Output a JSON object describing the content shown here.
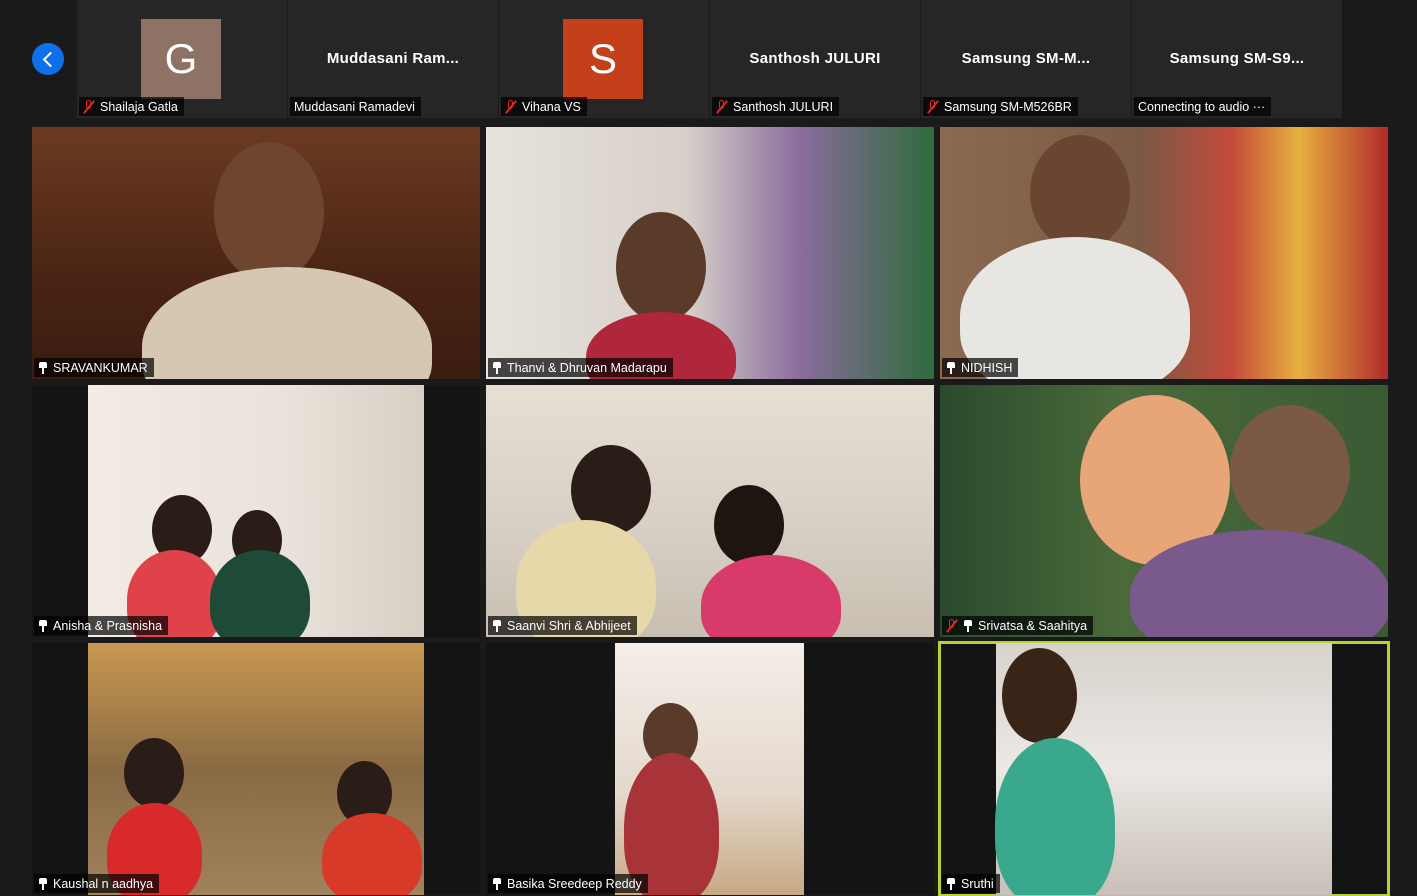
{
  "strip": {
    "participants": [
      {
        "avatar_letter": "G",
        "avatar_color": "#8d7265",
        "label": "Shailaja Gatla",
        "muted": true
      },
      {
        "display": "Muddasani  Ram...",
        "label": "Muddasani Ramadevi",
        "muted": false
      },
      {
        "avatar_letter": "S",
        "avatar_color": "#c3401a",
        "label": "Vihana VS",
        "muted": true
      },
      {
        "display": "Santhosh JULURI",
        "label": "Santhosh JULURI",
        "muted": true
      },
      {
        "display": "Samsung  SM-M...",
        "label": "Samsung SM-M526BR",
        "muted": true
      },
      {
        "display": "Samsung  SM-S9...",
        "label": "Connecting to audio ···",
        "muted": false
      }
    ],
    "nav_icon": "chevron-left-icon"
  },
  "grid": {
    "tiles": [
      {
        "name": "SRAVANKUMAR",
        "muted": false,
        "active": false
      },
      {
        "name": "Thanvi & Dhruvan Madarapu",
        "muted": false,
        "active": false
      },
      {
        "name": "NIDHISH",
        "muted": false,
        "active": false
      },
      {
        "name": "Anisha & Prasnisha",
        "muted": false,
        "active": false
      },
      {
        "name": "Saanvi Shri & Abhijeet",
        "muted": false,
        "active": false
      },
      {
        "name": "Srivatsa & Saahitya",
        "muted": true,
        "active": false
      },
      {
        "name": "Kaushal n aadhya",
        "muted": false,
        "active": false
      },
      {
        "name": "Basika Sreedeep Reddy",
        "muted": false,
        "active": false
      },
      {
        "name": "Sruthi",
        "muted": false,
        "active": true
      }
    ]
  },
  "colors": {
    "active_speaker_border": "#b5d332",
    "muted_mic": "#e02828",
    "nav_button": "#0e71eb"
  }
}
